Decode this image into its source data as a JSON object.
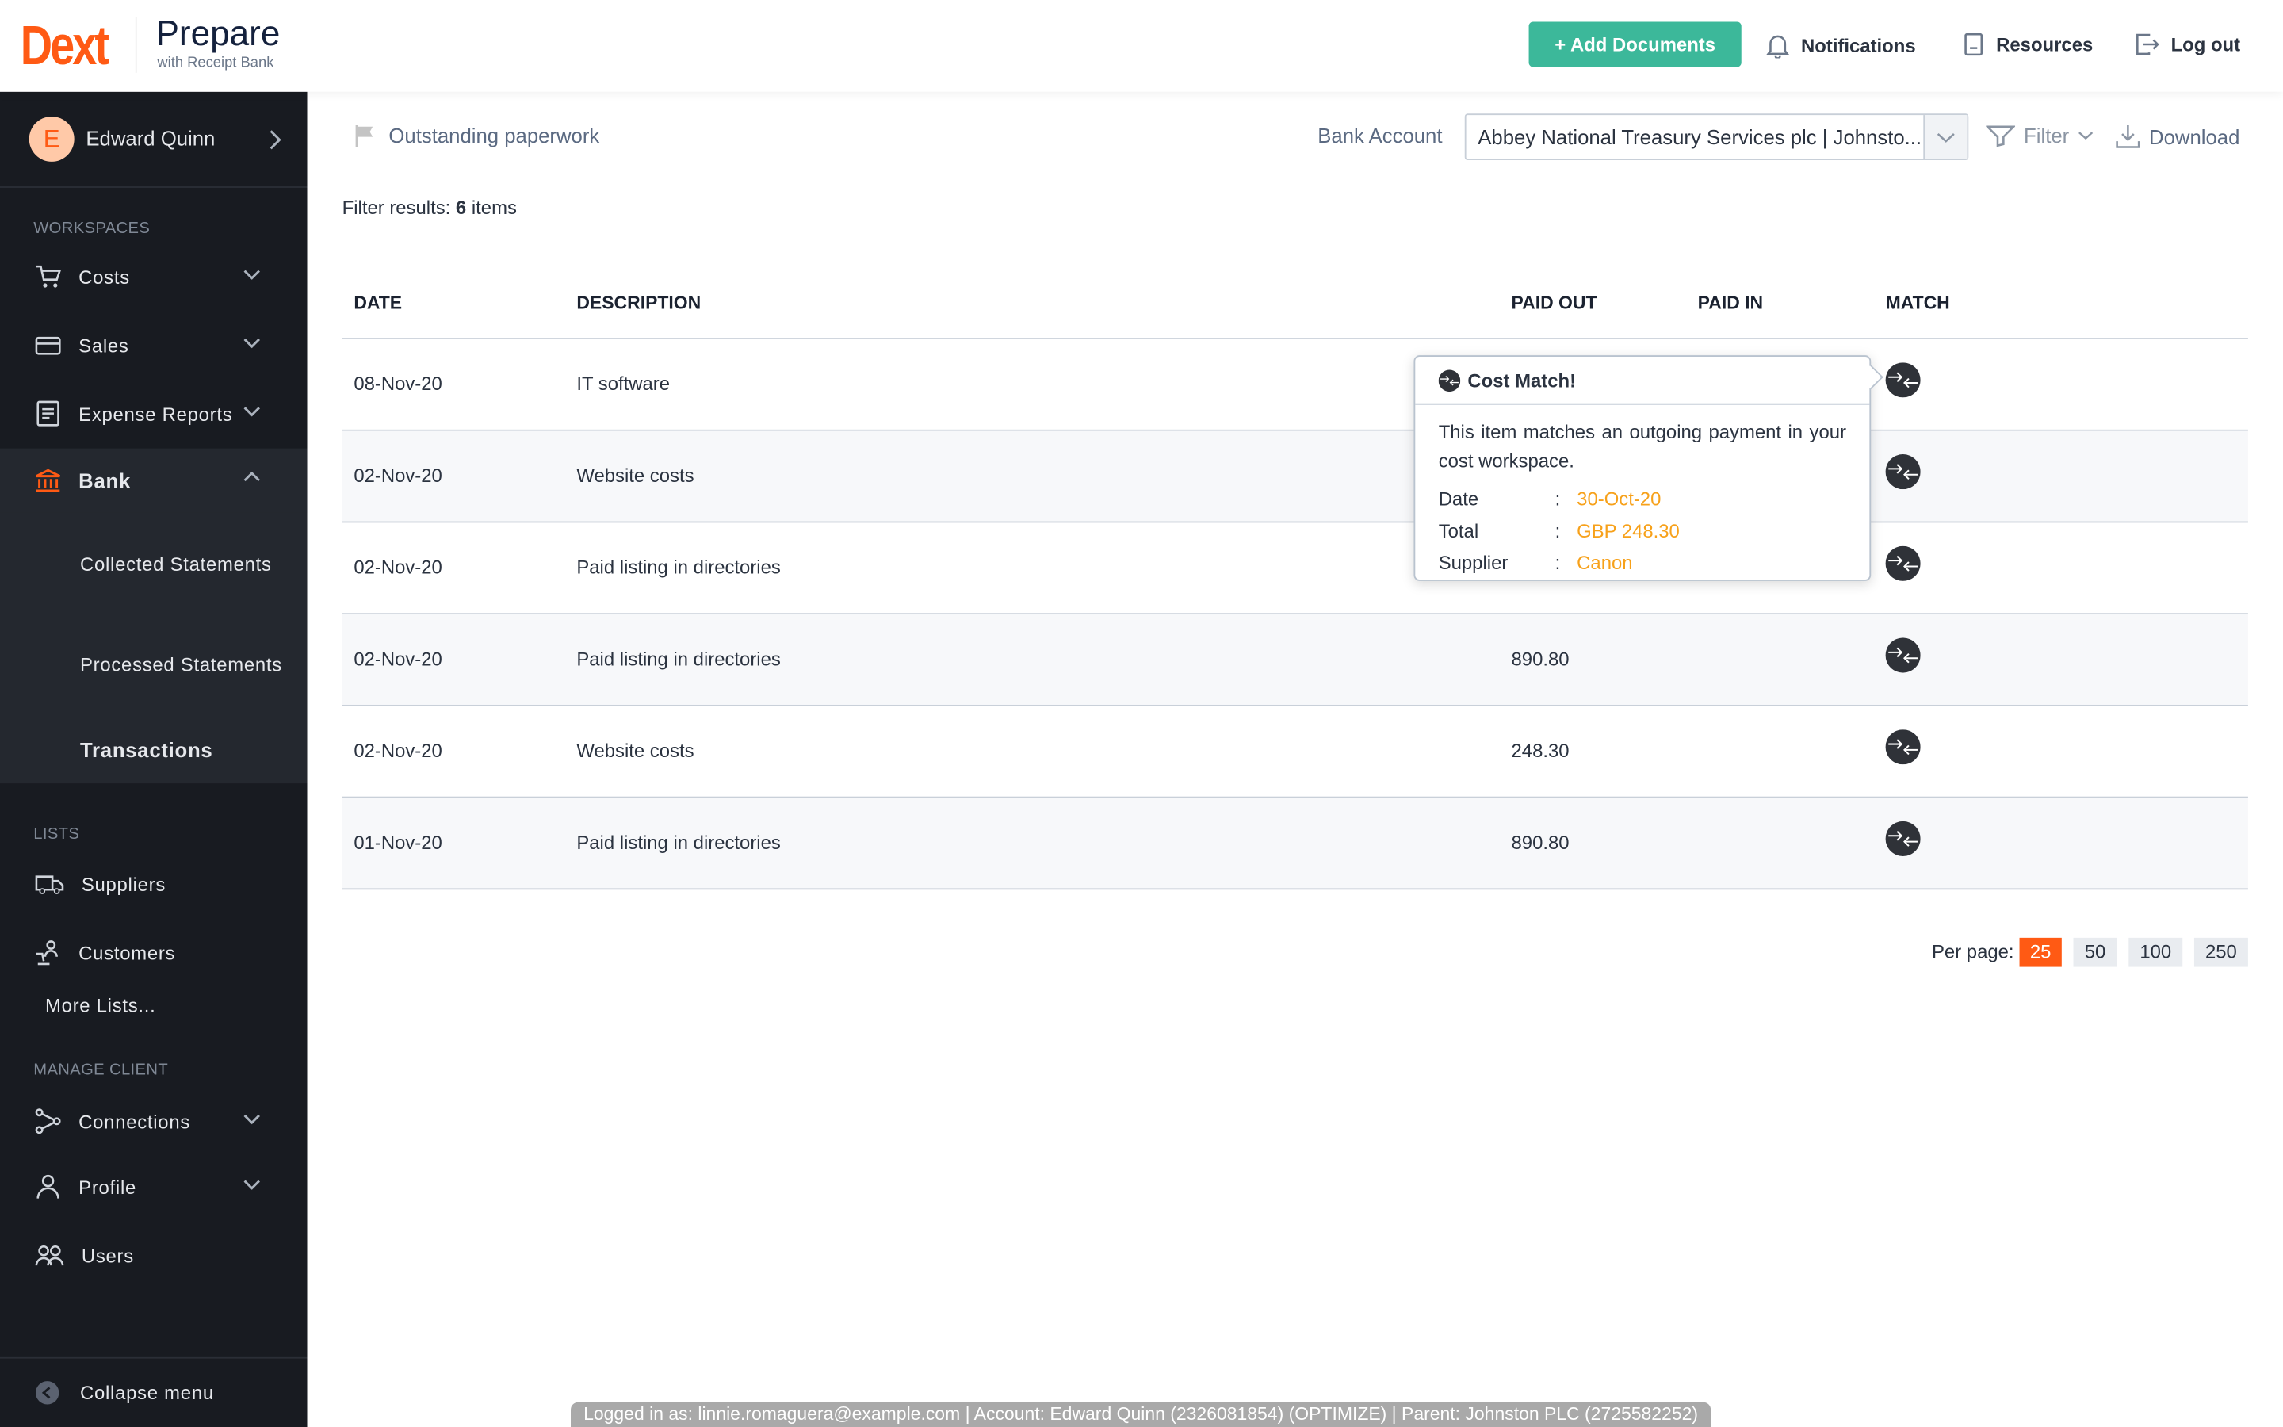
{
  "brand": {
    "logo": "Dext",
    "product": "Prepare",
    "subtitle": "with Receipt Bank",
    "accent": "#ff5a14"
  },
  "topnav": {
    "add_documents": "+ Add Documents",
    "notifications": "Notifications",
    "resources": "Resources",
    "logout": "Log out"
  },
  "sidebar": {
    "user": {
      "initial": "E",
      "name": "Edward Quinn"
    },
    "workspaces_heading": "WORKSPACES",
    "workspaces": [
      {
        "label": "Costs"
      },
      {
        "label": "Sales"
      },
      {
        "label": "Expense Reports"
      },
      {
        "label": "Bank"
      }
    ],
    "bank_sub": [
      "Collected Statements",
      "Processed Statements",
      "Transactions"
    ],
    "lists_heading": "LISTS",
    "lists": [
      {
        "label": "Suppliers"
      },
      {
        "label": "Customers"
      },
      {
        "label": "More Lists..."
      }
    ],
    "manage_heading": "MANAGE CLIENT",
    "manage": [
      {
        "label": "Connections"
      },
      {
        "label": "Profile"
      },
      {
        "label": "Users"
      }
    ],
    "collapse": "Collapse menu"
  },
  "toolbar": {
    "outstanding": "Outstanding paperwork",
    "bank_account_label": "Bank Account",
    "bank_account_value": "Abbey National Treasury Services plc | Johnsto...",
    "filter": "Filter",
    "download": "Download"
  },
  "filter_results": {
    "prefix": "Filter results: ",
    "count": "6",
    "suffix": " items"
  },
  "table": {
    "headers": [
      "DATE",
      "DESCRIPTION",
      "PAID OUT",
      "PAID IN",
      "MATCH"
    ],
    "rows": [
      {
        "date": "08-Nov-20",
        "description": "IT software",
        "paid_out": "",
        "paid_in": ""
      },
      {
        "date": "02-Nov-20",
        "description": "Website costs",
        "paid_out": "",
        "paid_in": ""
      },
      {
        "date": "02-Nov-20",
        "description": "Paid listing in directories",
        "paid_out": "",
        "paid_in": ""
      },
      {
        "date": "02-Nov-20",
        "description": "Paid listing in directories",
        "paid_out": "890.80",
        "paid_in": ""
      },
      {
        "date": "02-Nov-20",
        "description": "Website costs",
        "paid_out": "248.30",
        "paid_in": ""
      },
      {
        "date": "01-Nov-20",
        "description": "Paid listing in directories",
        "paid_out": "890.80",
        "paid_in": ""
      }
    ]
  },
  "tooltip": {
    "title": "Cost Match!",
    "body": "This item matches an outgoing payment in your cost workspace.",
    "fields": [
      {
        "k": "Date",
        "v": "30-Oct-20"
      },
      {
        "k": "Total",
        "v": "GBP 248.30"
      },
      {
        "k": "Supplier",
        "v": "Canon"
      }
    ]
  },
  "pagination": {
    "label": "Per page:",
    "options": [
      "25",
      "50",
      "100",
      "250"
    ],
    "selected": "25"
  },
  "footer": "Logged in as: linnie.romaguera@example.com | Account: Edward Quinn (2326081854) (OPTIMIZE) | Parent: Johnston PLC (2725582252)"
}
